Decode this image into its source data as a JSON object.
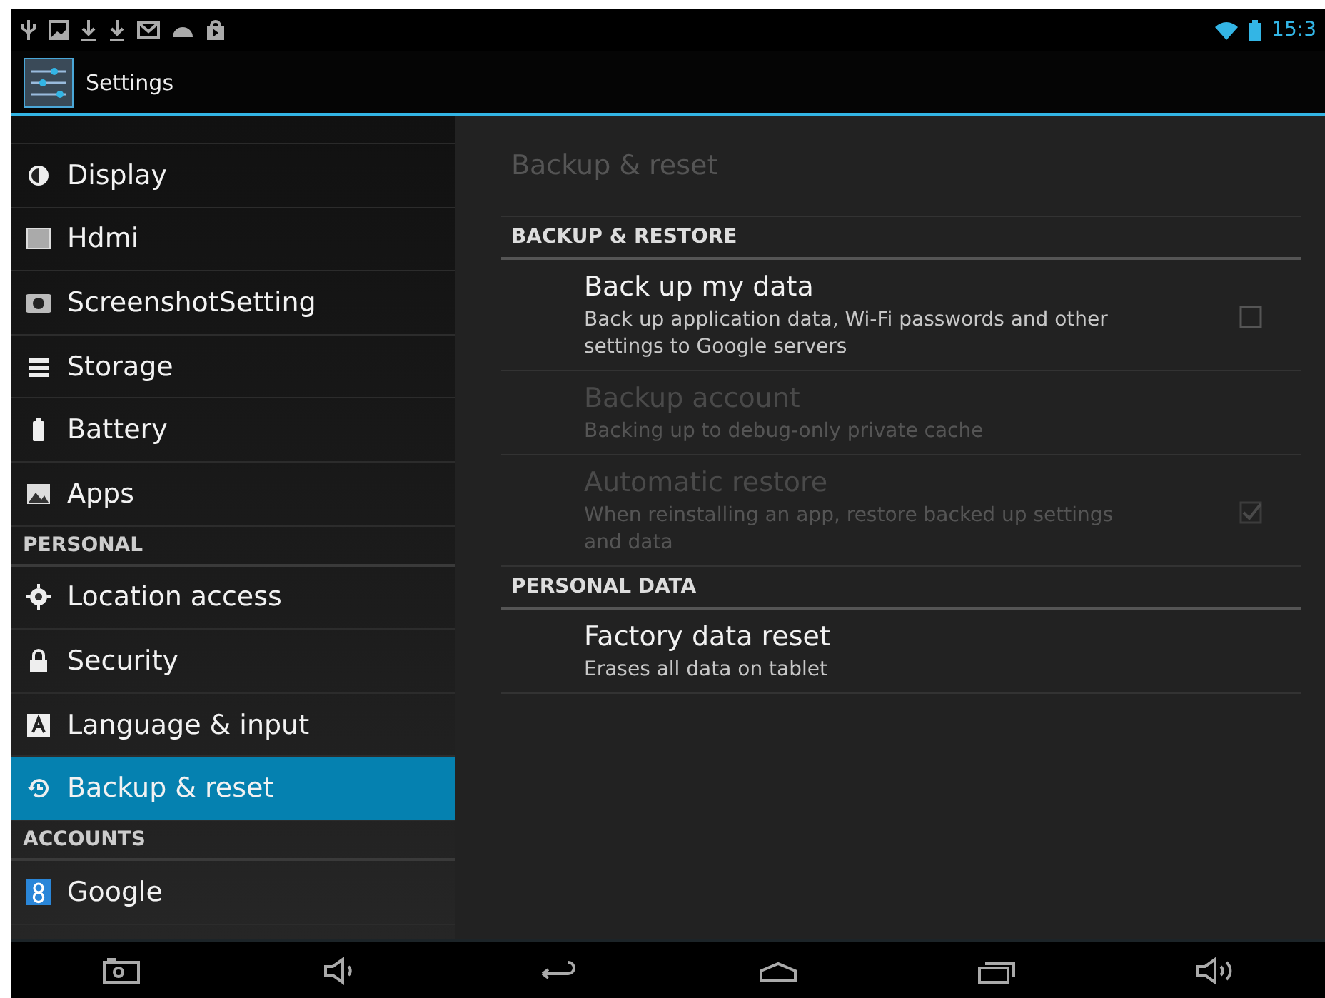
{
  "status_bar": {
    "time": "15:3"
  },
  "action_bar": {
    "title": "Settings"
  },
  "sidebar": {
    "items": [
      {
        "kind": "item",
        "label": "Display",
        "selected": false
      },
      {
        "kind": "item",
        "label": "Hdmi",
        "selected": false
      },
      {
        "kind": "item",
        "label": "ScreenshotSetting",
        "selected": false
      },
      {
        "kind": "item",
        "label": "Storage",
        "selected": false
      },
      {
        "kind": "item",
        "label": "Battery",
        "selected": false
      },
      {
        "kind": "item",
        "label": "Apps",
        "selected": false
      },
      {
        "kind": "header",
        "label": "PERSONAL"
      },
      {
        "kind": "item",
        "label": "Location access",
        "selected": false
      },
      {
        "kind": "item",
        "label": "Security",
        "selected": false
      },
      {
        "kind": "item",
        "label": "Language & input",
        "selected": false
      },
      {
        "kind": "item",
        "label": "Backup & reset",
        "selected": true
      },
      {
        "kind": "header",
        "label": "ACCOUNTS"
      },
      {
        "kind": "item",
        "label": "Google",
        "selected": false
      }
    ]
  },
  "panel": {
    "title": "Backup & reset",
    "sections": [
      {
        "header": "BACKUP & RESTORE",
        "prefs": [
          {
            "title": "Back up my data",
            "summary": "Back up application data, Wi-Fi passwords and other settings to Google servers",
            "disabled": false,
            "checkbox": true,
            "checked": false
          },
          {
            "title": "Backup account",
            "summary": "Backing up to debug-only private cache",
            "disabled": true,
            "checkbox": false
          },
          {
            "title": "Automatic restore",
            "summary": "When reinstalling an app, restore backed up settings and data",
            "disabled": true,
            "checkbox": true,
            "checked": true
          }
        ]
      },
      {
        "header": "PERSONAL DATA",
        "prefs": [
          {
            "title": "Factory data reset",
            "summary": "Erases all data on tablet",
            "disabled": false,
            "checkbox": false
          }
        ]
      }
    ]
  }
}
